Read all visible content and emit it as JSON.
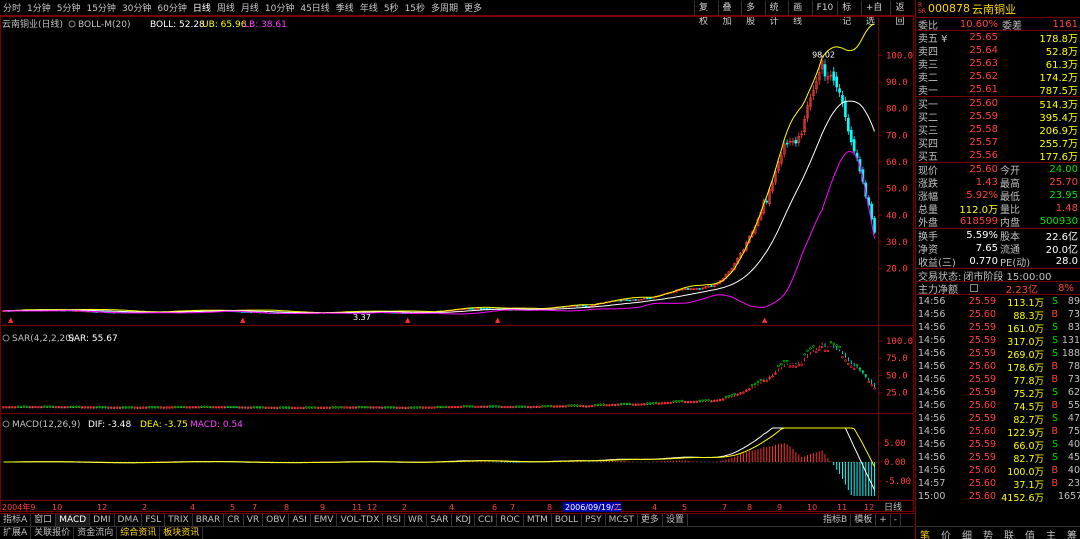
{
  "toolbar": {
    "periods": [
      "分时",
      "1分钟",
      "5分钟",
      "15分钟",
      "30分钟",
      "60分钟",
      "日线",
      "周线",
      "月线",
      "10分钟",
      "45日线",
      "季线",
      "年线",
      "5秒",
      "15秒",
      "多周期",
      "更多"
    ],
    "active_period": "日线",
    "right_buttons": [
      "复权",
      "叠加",
      "多股",
      "统计",
      "画线",
      "F10",
      "标记",
      "+自选",
      "返回"
    ]
  },
  "main_panel": {
    "title": "云南铜业(日线)",
    "indicator": "BOLL-M(20)",
    "boll": "BOLL: 52.28",
    "ub": "UB: 65.96",
    "lb": "LB: 38.61",
    "high_label": "98.02",
    "low_label": "3.37",
    "y_ticks": [
      "100.0",
      "90.0",
      "80.0",
      "70.0",
      "60.0",
      "50.0",
      "40.0",
      "30.0",
      "20.0"
    ]
  },
  "sar_panel": {
    "label": "SAR(4,2,2,20)",
    "value": "SAR: 55.67",
    "y_ticks": [
      "100.0",
      "75.0",
      "50.0",
      "25.0"
    ]
  },
  "macd_panel": {
    "label": "MACD(12,26,9)",
    "dif": "DIF: -3.48",
    "dea": "DEA: -3.75",
    "macd": "MACD: 0.54",
    "y_ticks": [
      "5.00",
      "0.00",
      "-5.00"
    ]
  },
  "x_axis": {
    "labels": [
      "2004年9",
      "10",
      "12",
      "2",
      "4",
      "5",
      "7",
      "8",
      "9",
      "11",
      "12",
      "2",
      "4",
      "6",
      "7",
      "8",
      "9",
      "2006/09/19/二",
      "2",
      "4",
      "5",
      "7",
      "8",
      "9",
      "10",
      "11",
      "12"
    ],
    "period_label": "日线"
  },
  "bottom_tabs": [
    "指标A",
    "窗口",
    "MACD",
    "DMI",
    "DMA",
    "FSL",
    "TRIX",
    "BRAR",
    "CR",
    "VR",
    "OBV",
    "ASI",
    "EMV",
    "VOL-TDX",
    "RSI",
    "WR",
    "SAR",
    "KDJ",
    "CCI",
    "ROC",
    "MTM",
    "BOLL",
    "PSY",
    "MCST",
    "更多",
    "设置"
  ],
  "bottom_tabs_right": [
    "指标B",
    "模板",
    "+",
    "-"
  ],
  "bottom_tabs2": [
    "扩展A",
    "关联报价",
    "资金流向",
    "综合资讯",
    "板块资讯"
  ],
  "quote": {
    "code": "000878",
    "name": "云南铜业",
    "rz_top": "R",
    "rz_bottom": "SR",
    "weibi_label": "委比",
    "weibi": "10.60%",
    "weicha_label": "委差",
    "weicha": "1161",
    "sells": [
      {
        "label": "卖五 ¥",
        "price": "25.65",
        "vol": "178.8万"
      },
      {
        "label": "卖四",
        "price": "25.64",
        "vol": "52.8万"
      },
      {
        "label": "卖三",
        "price": "25.63",
        "vol": "61.3万"
      },
      {
        "label": "卖二",
        "price": "25.62",
        "vol": "174.2万"
      },
      {
        "label": "卖一",
        "price": "25.61",
        "vol": "787.5万"
      }
    ],
    "buys": [
      {
        "label": "买一",
        "price": "25.60",
        "vol": "514.3万"
      },
      {
        "label": "买二",
        "price": "25.59",
        "vol": "395.4万"
      },
      {
        "label": "买三",
        "price": "25.58",
        "vol": "206.9万"
      },
      {
        "label": "买四",
        "price": "25.57",
        "vol": "255.7万"
      },
      {
        "label": "买五",
        "price": "25.56",
        "vol": "177.6万"
      }
    ],
    "stats": [
      {
        "l1": "现价",
        "v1": "25.60",
        "l2": "今开",
        "v2": "24.00",
        "c1": "red",
        "c2": "grn"
      },
      {
        "l1": "涨跌",
        "v1": "1.43",
        "l2": "最高",
        "v2": "25.70",
        "c1": "red",
        "c2": "red"
      },
      {
        "l1": "涨幅",
        "v1": "5.92%",
        "l2": "最低",
        "v2": "23.95",
        "c1": "red",
        "c2": "grn"
      },
      {
        "l1": "总量",
        "v1": "112.0万",
        "l2": "量比",
        "v2": "1.48",
        "c1": "yel",
        "c2": "red"
      },
      {
        "l1": "外盘",
        "v1": "618599",
        "l2": "内盘",
        "v2": "500930",
        "c1": "red",
        "c2": "grn"
      }
    ],
    "stats2": [
      {
        "l1": "换手",
        "v1": "5.59%",
        "l2": "股本",
        "v2": "22.6亿"
      },
      {
        "l1": "净资",
        "v1": "7.65",
        "l2": "流通",
        "v2": "20.0亿"
      },
      {
        "l1": "收益(三)",
        "v1": "0.770",
        "l2": "PE(动)",
        "v2": "28.0"
      }
    ],
    "status_label": "交易状态:",
    "status": "闭市阶段 15:00:00",
    "main_flow_label": "主力净额",
    "main_flow": "2.23亿",
    "main_flow_pct": "8%"
  },
  "ticks": [
    {
      "t": "14:56",
      "p": "25.59",
      "v": "113.1万",
      "bs": "S",
      "n": "89",
      "pc": "red",
      "bc": "grn"
    },
    {
      "t": "14:56",
      "p": "25.60",
      "v": "88.3万",
      "bs": "B",
      "n": "73",
      "pc": "red",
      "bc": "red"
    },
    {
      "t": "14:56",
      "p": "25.59",
      "v": "161.0万",
      "bs": "S",
      "n": "83",
      "pc": "red",
      "bc": "grn"
    },
    {
      "t": "14:56",
      "p": "25.59",
      "v": "317.0万",
      "bs": "S",
      "n": "131",
      "pc": "red",
      "bc": "grn"
    },
    {
      "t": "14:56",
      "p": "25.59",
      "v": "269.0万",
      "bs": "S",
      "n": "188",
      "pc": "red",
      "bc": "grn"
    },
    {
      "t": "14:56",
      "p": "25.60",
      "v": "178.6万",
      "bs": "B",
      "n": "78",
      "pc": "red",
      "bc": "red"
    },
    {
      "t": "14:56",
      "p": "25.59",
      "v": "77.8万",
      "bs": "B",
      "n": "73",
      "pc": "red",
      "bc": "red"
    },
    {
      "t": "14:56",
      "p": "25.59",
      "v": "75.2万",
      "bs": "S",
      "n": "62",
      "pc": "red",
      "bc": "grn"
    },
    {
      "t": "14:56",
      "p": "25.60",
      "v": "74.5万",
      "bs": "B",
      "n": "55",
      "pc": "red",
      "bc": "red"
    },
    {
      "t": "14:56",
      "p": "25.59",
      "v": "82.7万",
      "bs": "S",
      "n": "47",
      "pc": "red",
      "bc": "grn"
    },
    {
      "t": "14:56",
      "p": "25.60",
      "v": "122.9万",
      "bs": "B",
      "n": "75",
      "pc": "red",
      "bc": "red"
    },
    {
      "t": "14:56",
      "p": "25.59",
      "v": "66.0万",
      "bs": "S",
      "n": "40",
      "pc": "red",
      "bc": "grn"
    },
    {
      "t": "14:56",
      "p": "25.59",
      "v": "82.7万",
      "bs": "S",
      "n": "45",
      "pc": "red",
      "bc": "grn"
    },
    {
      "t": "14:56",
      "p": "25.60",
      "v": "100.0万",
      "bs": "B",
      "n": "40",
      "pc": "red",
      "bc": "red"
    },
    {
      "t": "14:57",
      "p": "25.60",
      "v": "37.1万",
      "bs": "B",
      "n": "23",
      "pc": "red",
      "bc": "red"
    },
    {
      "t": "15:00",
      "p": "25.60",
      "v": "4152.6万",
      "bs": "",
      "n": "1657",
      "pc": "red",
      "bc": "red"
    }
  ],
  "right_footer": [
    "笔",
    "价",
    "细",
    "势",
    "联",
    "值",
    "主",
    "筹"
  ],
  "colors": {
    "up": "#ff4040",
    "down": "#00e000",
    "boll_mid": "#ffffff",
    "boll_ub": "#ffff00",
    "boll_lb": "#ff00ff",
    "grid": "#7a0000",
    "sar_up": "#ff3030",
    "sar_down": "#00c000",
    "dif": "#ffffff",
    "dea": "#ffff00"
  }
}
